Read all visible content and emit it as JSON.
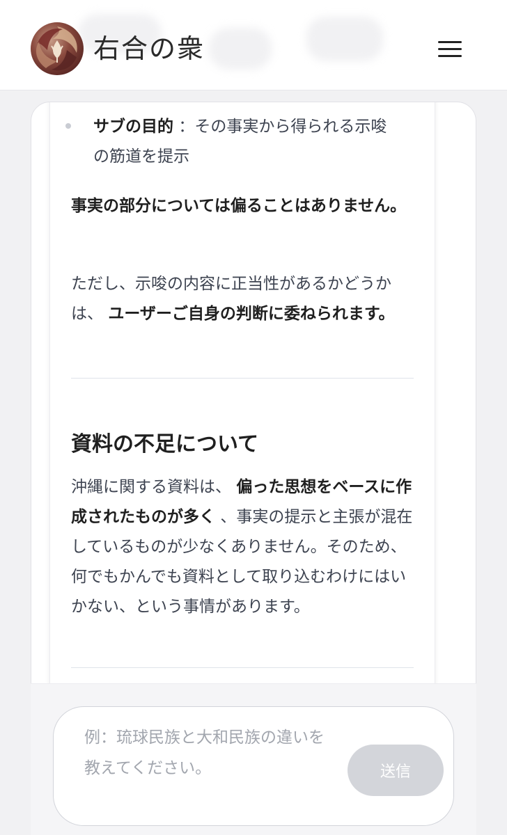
{
  "header": {
    "logo_text": "右合の衆",
    "menu_icon": "hamburger-menu-icon"
  },
  "content": {
    "bullet": {
      "label": "サブの目的",
      "text": "：その事実から得られる示唆の筋道を提示"
    },
    "p1": "事実の部分については偏ることはありません。",
    "p2_prefix": "ただし、示唆の内容に正当性があるかどうかは、",
    "p2_bold": "ユーザーご自身の判断に委ねられます。",
    "section_title": "資料の不足について",
    "p3_prefix": "沖縄に関する資料は、",
    "p3_bold": "偏った思想をベースに作成されたものが多く",
    "p3_suffix": "、事実の提示と主張が混在しているものが少なくありません。そのため、何でもかんでも資料として取り込むわけにはいかない、という事情があります。"
  },
  "input": {
    "placeholder": "例：琉球民族と大和民族の違いを教えてください。",
    "send_label": "送信"
  }
}
